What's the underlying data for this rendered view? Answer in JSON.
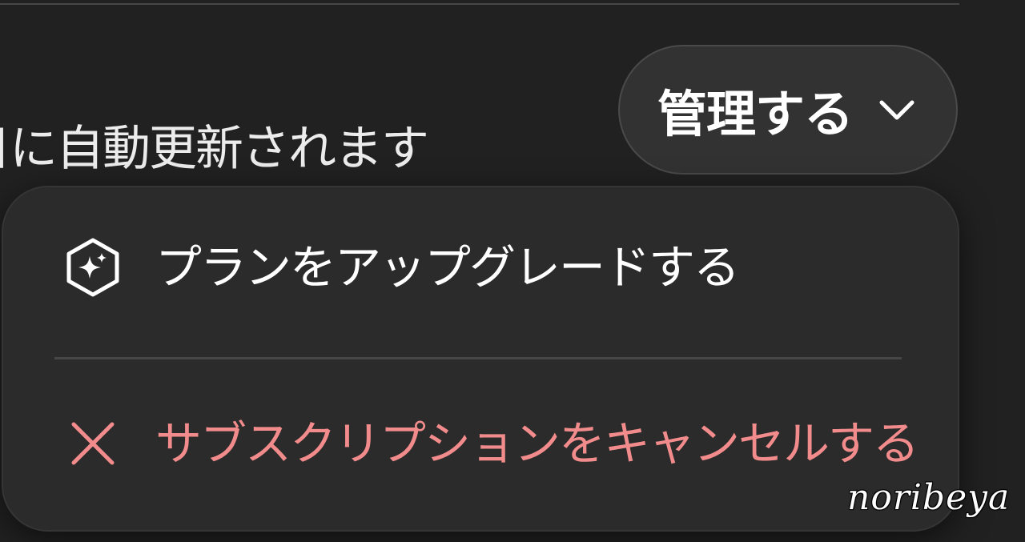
{
  "subscription": {
    "renewal_text": "日に自動更新されます"
  },
  "manage_button": {
    "label": "管理する",
    "icon": "chevron-down-icon"
  },
  "dropdown": {
    "items": [
      {
        "label": "プランをアップグレードする",
        "icon": "sparkle-hexagon-icon",
        "color": "#ffffff"
      },
      {
        "label": "サブスクリプションをキャンセルする",
        "icon": "close-icon",
        "color": "#f28b8b"
      }
    ]
  },
  "watermark": "noribeya",
  "colors": {
    "background": "#212121",
    "menu_background": "#2b2b2b",
    "button_background": "#323232",
    "danger": "#f28b8b"
  }
}
